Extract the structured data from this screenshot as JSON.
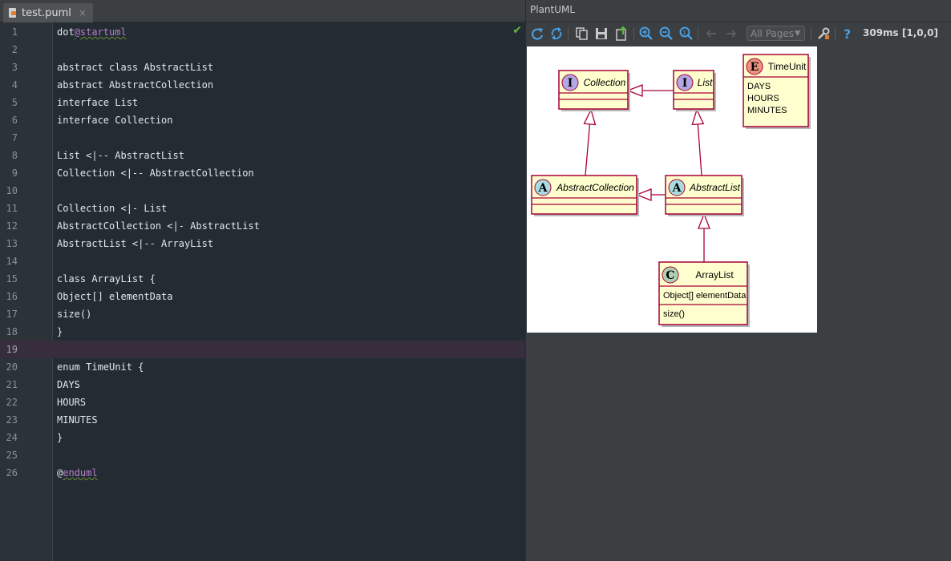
{
  "editor": {
    "tab": {
      "label": "test.puml",
      "close": "×"
    },
    "lines": [
      {
        "n": "1",
        "segments": [
          {
            "t": "dot"
          },
          {
            "t": "@startuml",
            "cls": "kw-at"
          }
        ]
      },
      {
        "n": "2",
        "segments": []
      },
      {
        "n": "3",
        "segments": [
          {
            "t": "abstract class AbstractList"
          }
        ]
      },
      {
        "n": "4",
        "segments": [
          {
            "t": "abstract AbstractCollection"
          }
        ]
      },
      {
        "n": "5",
        "segments": [
          {
            "t": "interface List"
          }
        ]
      },
      {
        "n": "6",
        "segments": [
          {
            "t": "interface Collection"
          }
        ]
      },
      {
        "n": "7",
        "segments": []
      },
      {
        "n": "8",
        "segments": [
          {
            "t": "List <|-- AbstractList"
          }
        ]
      },
      {
        "n": "9",
        "segments": [
          {
            "t": "Collection <|-- AbstractCollection"
          }
        ]
      },
      {
        "n": "10",
        "segments": []
      },
      {
        "n": "11",
        "segments": [
          {
            "t": "Collection <|- List"
          }
        ]
      },
      {
        "n": "12",
        "segments": [
          {
            "t": "AbstractCollection <|- AbstractList"
          }
        ]
      },
      {
        "n": "13",
        "segments": [
          {
            "t": "AbstractList <|-- ArrayList"
          }
        ]
      },
      {
        "n": "14",
        "segments": []
      },
      {
        "n": "15",
        "segments": [
          {
            "t": "class ArrayList {"
          }
        ]
      },
      {
        "n": "16",
        "segments": [
          {
            "t": "Object[] elementData"
          }
        ]
      },
      {
        "n": "17",
        "segments": [
          {
            "t": "size()"
          }
        ]
      },
      {
        "n": "18",
        "segments": [
          {
            "t": "}"
          }
        ]
      },
      {
        "n": "19",
        "segments": [],
        "current": true
      },
      {
        "n": "20",
        "segments": [
          {
            "t": "enum TimeUnit {"
          }
        ]
      },
      {
        "n": "21",
        "segments": [
          {
            "t": "DAYS"
          }
        ]
      },
      {
        "n": "22",
        "segments": [
          {
            "t": "HOURS"
          }
        ]
      },
      {
        "n": "23",
        "segments": [
          {
            "t": "MINUTES"
          }
        ]
      },
      {
        "n": "24",
        "segments": [
          {
            "t": "}"
          }
        ]
      },
      {
        "n": "25",
        "segments": []
      },
      {
        "n": "26",
        "segments": [
          {
            "t": "@"
          },
          {
            "t": "enduml",
            "cls": "kw-at"
          }
        ]
      }
    ]
  },
  "panel": {
    "title": "PlantUML",
    "toolbar": {
      "buttons": [
        "refresh-icon",
        "sync-icon",
        "copy-icon",
        "save-icon",
        "export-icon",
        "zoom-in-icon",
        "zoom-out-icon",
        "zoom-actual-icon",
        "prev-page-icon",
        "next-page-icon",
        "settings-icon",
        "help-icon"
      ],
      "pages_label": "All Pages",
      "timing": "309ms [1,0,0]"
    }
  },
  "diagram": {
    "classes": [
      {
        "id": "collection",
        "stereotype": "I",
        "name": "Collection",
        "italic": true,
        "fields": [],
        "methods": []
      },
      {
        "id": "list",
        "stereotype": "I",
        "name": "List",
        "italic": true,
        "fields": [],
        "methods": []
      },
      {
        "id": "timeunit",
        "stereotype": "E",
        "name": "TimeUnit",
        "italic": false,
        "fields": [
          "DAYS",
          "HOURS",
          "MINUTES"
        ],
        "methods": []
      },
      {
        "id": "abstractcollection",
        "stereotype": "A",
        "name": "AbstractCollection",
        "italic": true,
        "fields": [],
        "methods": []
      },
      {
        "id": "abstractlist",
        "stereotype": "A",
        "name": "AbstractList",
        "italic": true,
        "fields": [],
        "methods": []
      },
      {
        "id": "arraylist",
        "stereotype": "C",
        "name": "ArrayList",
        "italic": false,
        "fields": [
          "Object[] elementData"
        ],
        "methods": [
          "size()"
        ]
      }
    ],
    "colors": {
      "box_fill": "#fefece",
      "box_border": "#a80036",
      "interface": "#b4a7e5",
      "abstract": "#a9dcdf",
      "class": "#add1b2",
      "enum": "#eb937f"
    }
  }
}
